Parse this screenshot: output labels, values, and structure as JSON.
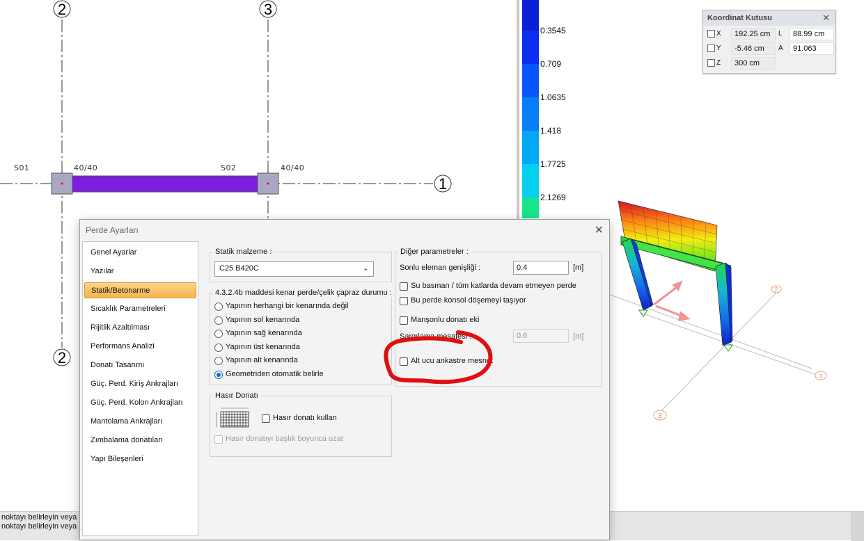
{
  "plan": {
    "axis_bubbles": [
      "2",
      "3",
      "1",
      "2"
    ],
    "labels": {
      "s01": "S01",
      "s01_size": "40/40",
      "s02": "S02",
      "s02_size": "40/40"
    },
    "colors": {
      "wall": "#7b1fe0",
      "column": "#a9a7c4"
    }
  },
  "legend": {
    "ticks": [
      "0.3545",
      "0.709",
      "1.0635",
      "1.418",
      "1.7725",
      "2.1269"
    ],
    "colors": [
      "#0b1fd6",
      "#0a2ff0",
      "#0a55f7",
      "#067ff7",
      "#04a8f5",
      "#05d0f0",
      "#13e0b9",
      "#16e58a"
    ]
  },
  "coord_box": {
    "title": "Koordinat Kutusu",
    "rows": [
      {
        "axis": "X",
        "value": "192.25 cm",
        "key": "L",
        "key_value": "88.99 cm"
      },
      {
        "axis": "Y",
        "value": "-5.46 cm",
        "key": "A",
        "key_value": "91.063"
      },
      {
        "axis": "Z",
        "value": "300 cm"
      }
    ]
  },
  "view3d_axis_labels": [
    "2",
    "1",
    "3"
  ],
  "status": {
    "line1": "noktayı belirleyin veya",
    "line2": "noktayı belirleyin veya"
  },
  "dialog": {
    "title": "Perde Ayarları",
    "nav": [
      "Genel Ayarlar",
      "Yazılar",
      "Statik/Betonarme",
      "Sıcaklık Parametreleri",
      "Rijitlik Azaltılması",
      "Performans Analizi",
      "Donatı Tasarımı",
      "Güç. Perd. Kiriş Ankrajları",
      "Güç. Perd. Kolon Ankrajları",
      "Mantolama Ankrajları",
      "Zımbalama donatıları",
      "Yapı Bileşenleri"
    ],
    "selected_nav": "Statik/Betonarme",
    "statik": {
      "label": "Statik malzeme :",
      "value": "C25 B420C"
    },
    "kenar": {
      "label": "4.3.2.4b maddesi kenar perde/çelik çapraz durumu :",
      "options": [
        "Yapının herhangi bir kenarında değil",
        "Yapının sol kenarında",
        "Yapının sağ kenarında",
        "Yapının üst kenarında",
        "Yapının alt kenarında",
        "Geometriden otomatik belirle"
      ],
      "selected": "Geometriden otomatik belirle"
    },
    "hasir": {
      "label": "Hasır Donatı",
      "use_label": "Hasır donatı kullan",
      "extend_label": "Hasır donatıyı başlık boyunca uzat"
    },
    "diger": {
      "label": "Diğer parametreler :",
      "fe_width_label": "Sonlu eleman genişliği :",
      "fe_width_value": "0.4",
      "fe_unit": "[m]",
      "bodrum_label": "Su basman / tüm katlarda devam etmeyen perde",
      "konsol_label": "Bu perde konsol döşemeyi taşıyor",
      "manson_label": "Manşonlu donatı eki",
      "mesafe_label": "Sargılama mesafesi :",
      "mesafe_value": "0.6",
      "mesafe_unit": "[m]",
      "ankastre_label": "Alt ucu ankastre mesnet"
    }
  }
}
